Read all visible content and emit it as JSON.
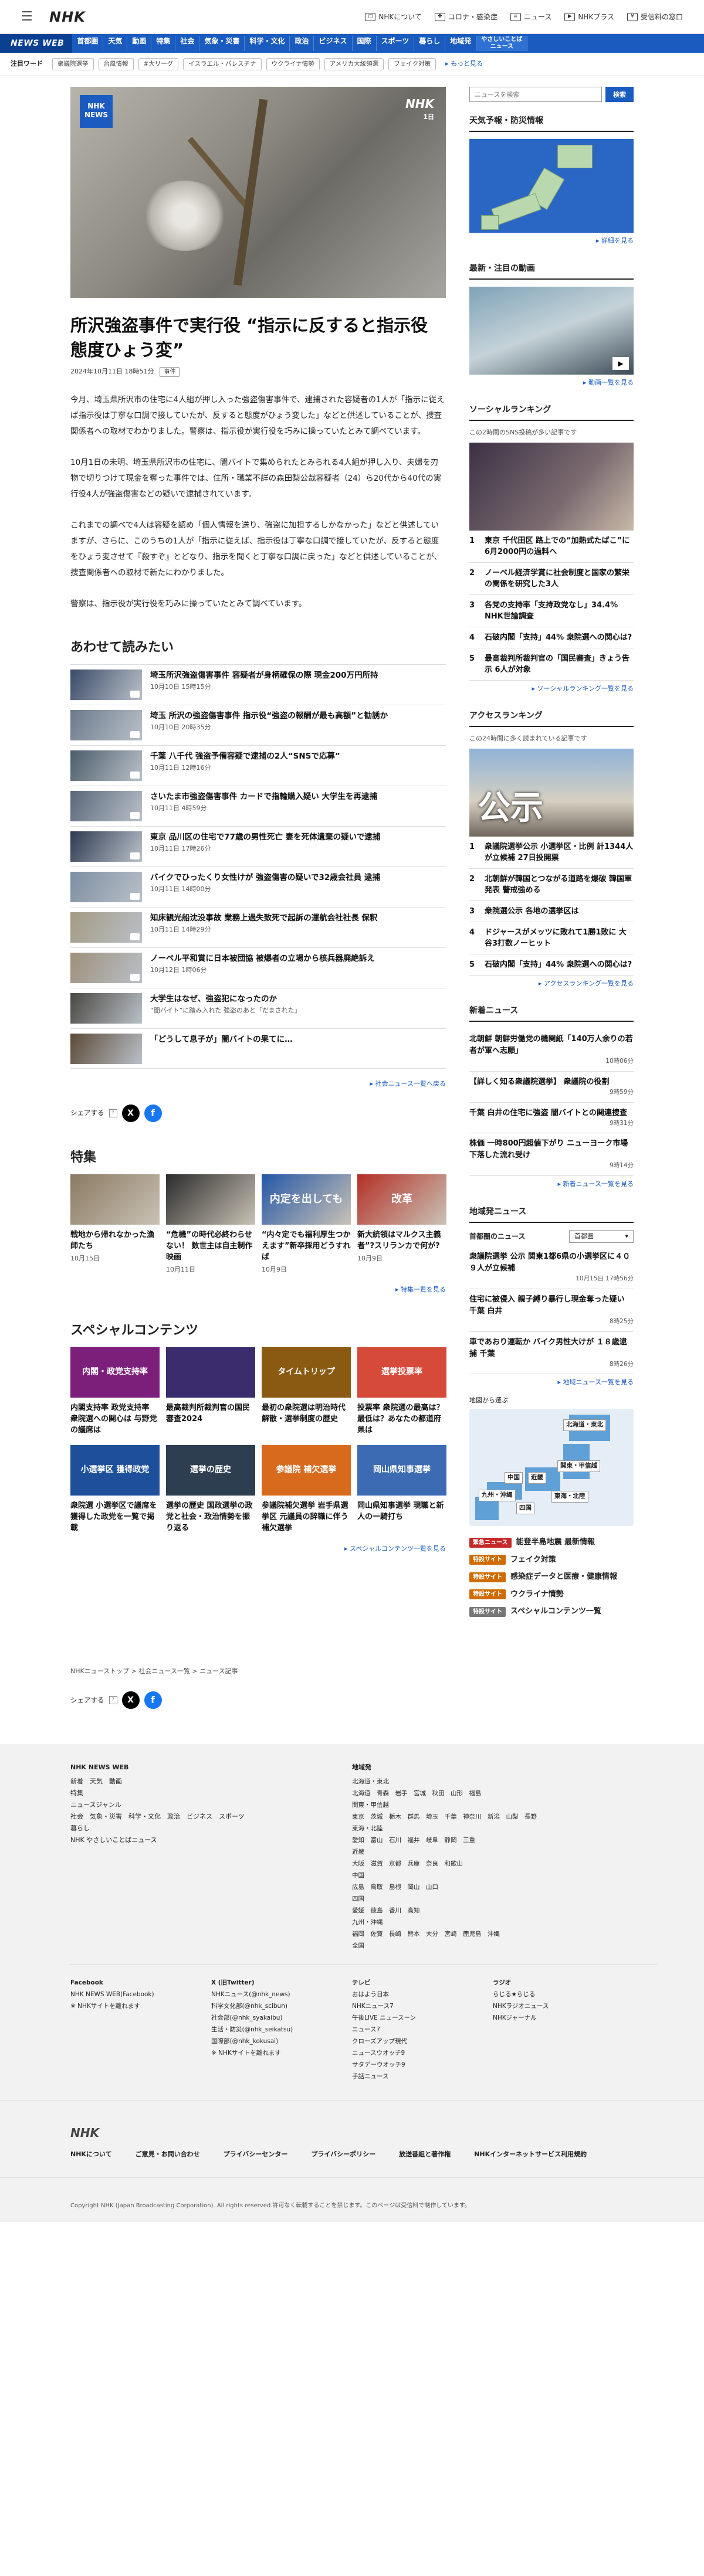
{
  "header": {
    "logo": "NHK",
    "links": [
      "NHKについて",
      "コロナ・感染症",
      "ニュース",
      "NHKプラス",
      "受信料の窓口"
    ]
  },
  "nav": {
    "brand": "NEWS WEB",
    "items": [
      "首都圏",
      "天気",
      "動画",
      "特集",
      "社会",
      "気象・災害",
      "科学・文化",
      "政治",
      "ビジネス",
      "国際",
      "スポーツ",
      "暮らし",
      "地域発"
    ],
    "easy": "やさしいことば\nニュース"
  },
  "attention": {
    "label": "注目ワード",
    "tags": [
      "衆議院選挙",
      "台風情報",
      "#大リーグ",
      "イスラエル・パレスチナ",
      "ウクライナ情勢",
      "アメリカ大統領選",
      "フェイク対策"
    ],
    "more": "もっと見る"
  },
  "article": {
    "hero_tag": "NHK\nNEWS",
    "hero_wm": "NHK",
    "hero_day": "1日",
    "title": "所沢強盗事件で実行役 “指示に反すると指示役 態度ひょう変”",
    "date": "2024年10月11日 18時51分",
    "category": "事件",
    "paragraphs": [
      "今月、埼玉県所沢市の住宅に4人組が押し入った強盗傷害事件で、逮捕された容疑者の1人が「指示に従えば指示役は丁寧な口調で接していたが、反すると態度がひょう変した」などと供述していることが、捜査関係者への取材でわかりました。警察は、指示役が実行役を巧みに操っていたとみて調べています。",
      "10月1日の未明、埼玉県所沢市の住宅に、闇バイトで集められたとみられる4人組が押し入り、夫婦を刃物で切りつけて現金を奪った事件では、住所・職業不詳の森田梨公哉容疑者（24）ら20代から40代の実行役4人が強盗傷害などの疑いで逮捕されています。",
      "これまでの調べで4人は容疑を認め「個人情報を送り、強盗に加担するしかなかった」などと供述していますが、さらに、このうちの1人が「指示に従えば、指示役は丁寧な口調で接していたが、反すると態度をひょう変させて『殺すぞ』とどなり、指示を聞くと丁寧な口調に戻った」などと供述していることが、捜査関係者への取材で新たにわかりました。",
      "警察は、指示役が実行役を巧みに操っていたとみて調べています。"
    ]
  },
  "related": {
    "heading": "あわせて読みたい",
    "items": [
      {
        "title": "埼玉所沢強盗傷害事件 容疑者が身柄確保の際 現金200万円所持",
        "date": "10月10日 15時15分"
      },
      {
        "title": "埼玉 所沢の強盗傷害事件 指示役“強盗の報酬が最も高額”と勧誘か",
        "date": "10月10日 20時35分"
      },
      {
        "title": "千葉 八千代 強盗予備容疑で逮捕の2人“SNSで応募”",
        "date": "10月11日 12時16分"
      },
      {
        "title": "さいたま市強盗傷害事件 カードで指輪購入疑い 大学生を再逮捕",
        "date": "10月11日 4時59分"
      },
      {
        "title": "東京 品川区の住宅で77歳の男性死亡 妻を死体遺棄の疑いで逮捕",
        "date": "10月11日 17時26分"
      },
      {
        "title": "バイクでひったくり女性けが 強盗傷害の疑いで32歳会社員 逮捕",
        "date": "10月11日 14時00分"
      },
      {
        "title": "知床観光船沈没事故 業務上過失致死で起訴の運航会社社長 保釈",
        "date": "10月11日 14時29分"
      },
      {
        "title": "ノーベル平和賞に日本被団協 被爆者の立場から核兵器廃絶訴え",
        "date": "10月12日 1時06分"
      },
      {
        "title": "大学生はなぜ、強盗犯になったのか",
        "date": "“闇バイト”に踏み入れた 強盗のあと「だまされた」"
      },
      {
        "title": "「どうして息子が」闇バイトの果てに…",
        "date": ""
      }
    ],
    "more": "社会ニュース一覧へ戻る"
  },
  "share": {
    "label": "シェアする",
    "x": "X",
    "fb": "f"
  },
  "features": {
    "heading": "特集",
    "items": [
      {
        "title": "戦地から帰れなかった漁師たち",
        "date": "10月15日",
        "img_text": ""
      },
      {
        "title": "“危機”の時代必終わらせない！ 数世主は自主制作映画",
        "date": "10月11日",
        "img_text": ""
      },
      {
        "title": "“内々定でも福利厚生つかえます”新卒採用どうすれば",
        "date": "10月9日",
        "img_text": "内定を出しても"
      },
      {
        "title": "新大統領はマルクス主義者”?スリランカで何が?",
        "date": "10月9日",
        "img_text": "改革"
      }
    ],
    "more": "特集一覧を見る"
  },
  "special": {
    "heading": "スペシャルコンテンツ",
    "items": [
      {
        "title": "内閣支持率 政党支持率 衆院選への関心は 与野党の議席は",
        "img_text": "内閣・政党支持率"
      },
      {
        "title": "最高裁判所裁判官の国民審査2024",
        "img_text": ""
      },
      {
        "title": "最初の衆院選は明治時代 解散・選挙制度の歴史",
        "img_text": "タイムトリップ"
      },
      {
        "title": "投票率 衆院選の最高は？最低は？あなたの都道府県は",
        "img_text": "選挙投票率"
      },
      {
        "title": "衆院選 小選挙区で議席を獲得した政党を一覧で掲載",
        "img_text": "小選挙区 獲得政党"
      },
      {
        "title": "選挙の歴史 国政選挙の政党と社会・政治情勢を振り返る",
        "img_text": "選挙の歴史"
      },
      {
        "title": "参議院補欠選挙 岩手県選挙区 元議員の辞職に伴う補欠選挙",
        "img_text": "参議院 補欠選挙"
      },
      {
        "title": "岡山県知事選挙 現職と新人の一騎打ち",
        "img_text": "岡山県知事選挙"
      }
    ],
    "more": "スペシャルコンテンツ一覧を見る"
  },
  "breadcrumb": [
    "NHKニューストップ",
    "社会ニュース一覧",
    "ニュース記事"
  ],
  "sidebar": {
    "search_placeholder": "ニュースを検索",
    "search_btn": "検索",
    "weather": {
      "heading": "天気予報・防災情報",
      "more": "詳細を見る"
    },
    "video": {
      "heading": "最新・注目の動画",
      "caption": "動画一覧を見る"
    },
    "social": {
      "heading": "ソーシャルランキング",
      "note": "この2時間のSNS投稿が多い記事です",
      "items": [
        "東京 千代田区 路上での“加熱式たばこ”に6月2000円の過料へ",
        "ノーベル経済学賞に社会制度と国家の繁栄の関係を研究した3人",
        "各党の支持率「支持政党なし」34.4% NHK世論調査",
        "石破内閣「支持」44% 衆院選への関心は?",
        "最高裁判所裁判官の「国民審査」きょう告示 6人が対象"
      ],
      "more": "ソーシャルランキング一覧を見る"
    },
    "access": {
      "heading": "アクセスランキング",
      "note": "この24時間に多く読まれている記事です",
      "img_text": "公示",
      "items": [
        "衆議院選挙公示 小選挙区・比例 計1344人が立候補 27日投開票",
        "北朝鮮が韓国とつながる道路を爆破 韓国軍発表 警戒強める",
        "衆院選公示 各地の選挙区は",
        "ドジャースがメッツに敗れて1勝1敗に 大谷3打数ノーヒット",
        "石破内閣「支持」44% 衆院選への関心は?"
      ],
      "more": "アクセスランキング一覧を見る"
    },
    "latest": {
      "heading": "新着ニュース",
      "items": [
        {
          "title": "北朝鮮 朝鮮労働党の機関紙「140万人余りの若者が軍へ志願」",
          "date": "10時06分"
        },
        {
          "title": "【詳しく知る衆議院選挙】 衆議院の役割",
          "date": "9時59分"
        },
        {
          "title": "千葉 白井の住宅に強盗 闇バイトとの関連捜査",
          "date": "9時31分"
        },
        {
          "title": "株価 一時800円超値下がり ニューヨーク市場下落した流れ受け",
          "date": "9時14分"
        }
      ],
      "more": "新着ニュース一覧を見る"
    },
    "local": {
      "heading": "地域発ニュース",
      "region_label": "首都圏のニュース",
      "region_sel": "首都圏",
      "items": [
        {
          "title": "衆議院選挙 公示 関東1都6県の小選挙区に４０９人が立候補",
          "date": "10月15日 17時56分"
        },
        {
          "title": "住宅に被侵入 親子縛り暴行し現金奪った疑い 千葉 白井",
          "date": "8時25分"
        },
        {
          "title": "車であおり運転か バイク男性大けが １８歳逮捕 千葉",
          "date": "8時26分"
        }
      ],
      "more": "地域ニュース一覧を見る",
      "map_label": "地図から選ぶ",
      "regions": [
        "北海道・東北",
        "関東・甲信越",
        "近畿",
        "中国",
        "九州・沖縄",
        "四国",
        "東海・北陸"
      ]
    },
    "promos": [
      {
        "badge": "緊急ニュース",
        "text": "能登半島地震 最新情報",
        "color": "#c62828"
      },
      {
        "badge": "特設サイト",
        "text": "フェイク対策",
        "color": "#d06b00"
      },
      {
        "badge": "特設サイト",
        "text": "感染症データと医療・健康情報",
        "color": "#d06b00"
      },
      {
        "badge": "特設サイト",
        "text": "ウクライナ情勢",
        "color": "#d06b00"
      },
      {
        "badge": "特設サイト",
        "text": "スペシャルコンテンツ一覧",
        "color": "#777777"
      }
    ]
  },
  "footer": {
    "title": "NHK NEWS WEB",
    "lines": [
      "新着　天気　動画",
      "特集",
      "ニュースジャンル",
      "社会　気象・災害　科学・文化　政治　ビジネス　スポーツ",
      "暮らし",
      "NHK やさしいことばニュース"
    ],
    "region_title": "地域発",
    "region_lines": [
      "北海道・東北",
      "北海道　青森　岩手　宮城　秋田　山形　福島",
      "関東・甲信越",
      "東京　茨城　栃木　群馬　埼玉　千葉　神奈川　新潟　山梨　長野",
      "東海・北陸",
      "愛知　富山　石川　福井　岐阜　静岡　三重",
      "近畿",
      "大阪　滋賀　京都　兵庫　奈良　和歌山",
      "中国",
      "広島　鳥取　島根　岡山　山口",
      "四国",
      "愛媛　徳島　香川　高知",
      "九州・沖縄",
      "福岡　佐賀　長崎　熊本　大分　宮崎　鹿児島　沖縄",
      "全国"
    ],
    "sns": [
      {
        "head": "Facebook",
        "lines": [
          "NHK NEWS WEB(Facebook)",
          "※ NHKサイトを離れます"
        ]
      },
      {
        "head": "X (旧Twitter)",
        "lines": [
          "NHKニュース(@nhk_news)",
          "科学文化部(@nhk_scibun)",
          "社会部(@nhk_syakaibu)",
          "生活・防災(@nhk_seikatsu)",
          "国際部(@nhk_kokusai)",
          "※ NHKサイトを離れます"
        ]
      },
      {
        "head": "テレビ",
        "lines": [
          "おはよう日本",
          "NHKニュース7",
          "午後LIVE ニュースーン",
          "ニュース7",
          "クローズアップ現代",
          "ニュースウオッチ9",
          "サタデーウオッチ9",
          "手話ニュース"
        ]
      },
      {
        "head": "ラジオ",
        "lines": [
          "らじる★らじる",
          "NHKラジオニュース",
          "NHKジャーナル"
        ]
      }
    ],
    "logo": "NHK",
    "links": [
      "NHKについて",
      "ご意見・お問い合わせ",
      "プライバシーセンター",
      "プライバシーポリシー",
      "放送番組と著作権",
      "NHKインターネットサービス利用規約"
    ],
    "copyright": "Copyright NHK (Japan Broadcasting Corporation). All rights reserved.許可なく転載することを禁じます。このページは受信料で制作しています。"
  }
}
